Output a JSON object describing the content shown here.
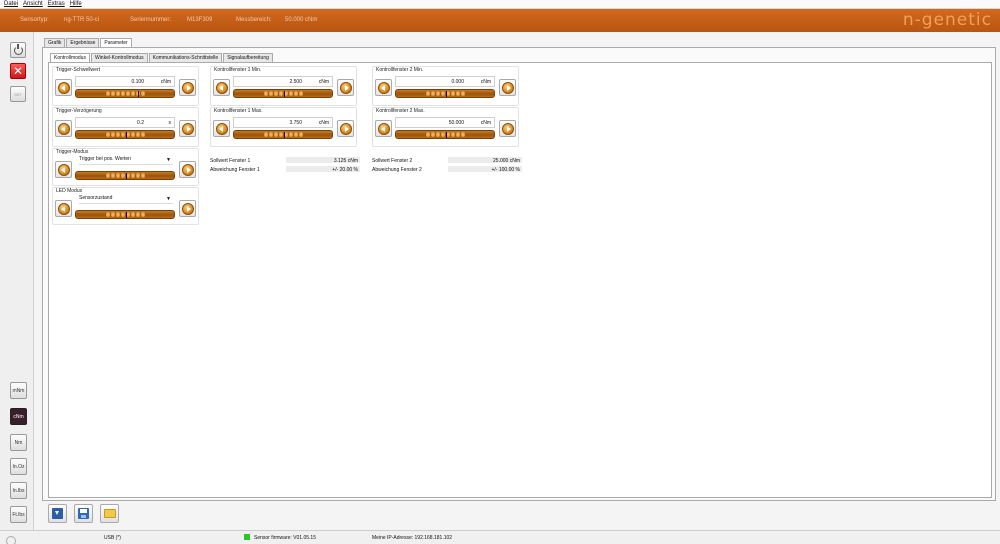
{
  "menu": [
    "Datei",
    "Ansicht",
    "Extras",
    "Hilfe"
  ],
  "header": {
    "sensor_type_label": "Sensortyp:",
    "sensor_type": "ng-TTR 50-ci",
    "serial_label": "Seriennummer:",
    "serial": "M13F309",
    "range_label": "Messbereich:",
    "range": "50.000 cNm",
    "brand": "n-genetic"
  },
  "sidebar": {
    "units": [
      "mNm",
      "cNm",
      "Nm",
      "In.Oz",
      "In.lbs",
      "Ft.lbs"
    ],
    "active_unit": "cNm",
    "set_label": "SET"
  },
  "tabs_main": [
    "Grafik",
    "Ergebnisse",
    "Parameter"
  ],
  "tabs_sub": [
    "Kontrollmodus",
    "Winkel-Kontrollmodus",
    "Kommunikations-Schnittstelle",
    "Signalaufbereitung"
  ],
  "params": {
    "trigger_threshold": {
      "label": "Trigger-Schwellwert",
      "value": "0.100",
      "unit": "cNm"
    },
    "trigger_delay": {
      "label": "Trigger-Verzögerung",
      "value": "0.2",
      "unit": "s"
    },
    "trigger_mode": {
      "label": "Trigger-Modus",
      "value": "Trigger bei pos. Werten"
    },
    "led_mode": {
      "label": "LED Modus",
      "value": "Sensorzustand"
    },
    "window1_min": {
      "label": "Kontrollfenster 1 Min.",
      "value": "2.500",
      "unit": "cNm"
    },
    "window1_max": {
      "label": "Kontrollfenster 1 Max.",
      "value": "3.750",
      "unit": "cNm"
    },
    "window2_min": {
      "label": "Kontrollfenster 2 Min.",
      "value": "0.000",
      "unit": "cNm"
    },
    "window2_max": {
      "label": "Kontrollfenster 2 Max.",
      "value": "50.000",
      "unit": "cNm"
    }
  },
  "info": {
    "setpoint1_label": "Sollwert Fenster 1",
    "setpoint1": "3.125 cNm",
    "deviation1_label": "Abweichung Fenster 1",
    "deviation1": "+/- 20.00 %",
    "setpoint2_label": "Sollwert Fenster 2",
    "setpoint2": "25.000 cNm",
    "deviation2_label": "Abweichung Fenster 2",
    "deviation2": "+/- 100.00 %"
  },
  "status": {
    "connection": "USB (*)",
    "firmware": "Sensor firmware: V01.05.15",
    "ip": "Meine IP-Adresse: 192.168.181.102"
  },
  "colors": {
    "accent": "#c8601a",
    "status_ok": "#22cc22",
    "active_unit_bg": "#3a1e2c"
  }
}
